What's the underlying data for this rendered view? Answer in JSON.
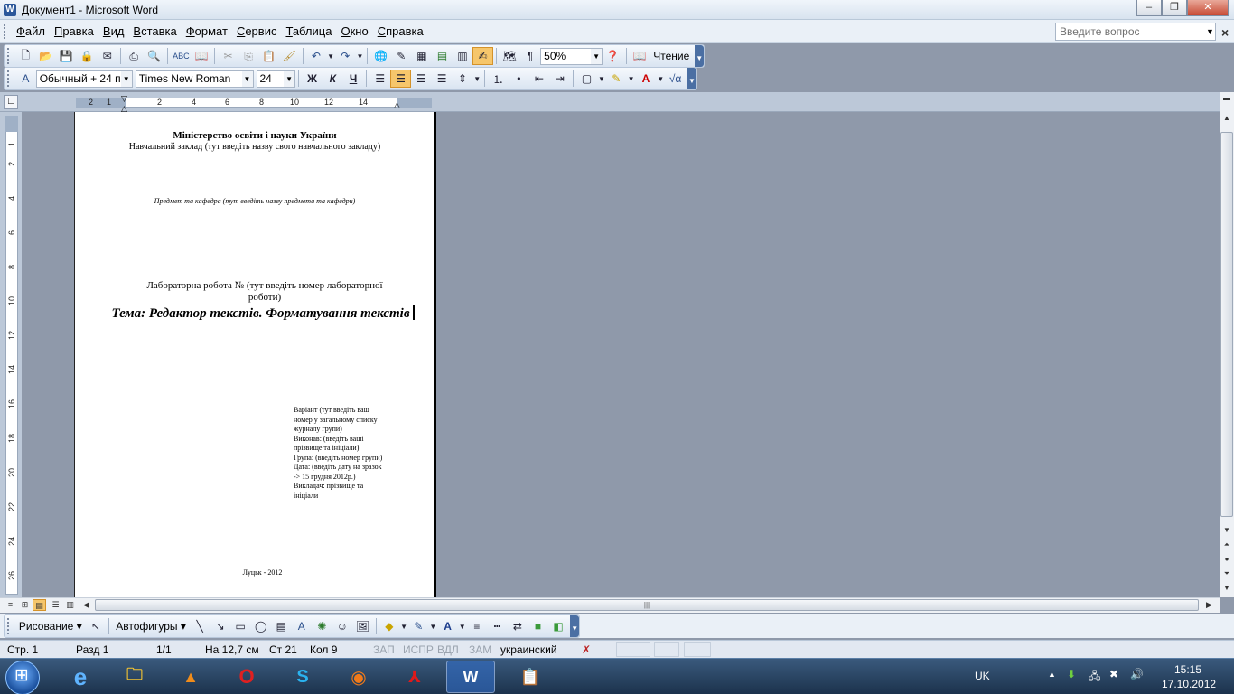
{
  "window": {
    "title": "Документ1 - Microsoft Word",
    "min": "–",
    "max": "❐",
    "close": "✕"
  },
  "menu": {
    "items": [
      "Файл",
      "Правка",
      "Вид",
      "Вставка",
      "Формат",
      "Сервис",
      "Таблица",
      "Окно",
      "Справка"
    ],
    "ask_placeholder": "Введите вопрос"
  },
  "toolbar_standard": {
    "zoom": "50%",
    "reading_label": "Чтение"
  },
  "toolbar_format": {
    "style": "Обычный + 24 п",
    "font": "Times New Roman",
    "size": "24",
    "bold": "Ж",
    "italic": "К",
    "underline": "Ч"
  },
  "ruler": {
    "h_marks": [
      "2",
      "1",
      "2",
      "4",
      "6",
      "8",
      "10",
      "12",
      "14"
    ],
    "v_marks": [
      "1",
      "2",
      "4",
      "6",
      "8",
      "10",
      "12",
      "14",
      "16",
      "18",
      "20",
      "22",
      "24",
      "26"
    ]
  },
  "document": {
    "ministry": "Міністерство освіти і науки України",
    "institution": "Навчальний заклад (тут введіть назву свого навчального закладу)",
    "subject": "Предмет та кафедра (тут введіть назву предмета та кафедри)",
    "lab_line": "Лабораторна робота № (тут введіть номер лабораторної роботи)",
    "topic": "Тема: Редактор текстів. Форматування текстів",
    "info_lines": [
      "Варіант (тут введіть ваш",
      "номер у загальному списку",
      "журналу групи)",
      "Виконав: (введіть ваші",
      "прізвище та ініціали)",
      "Група: (введіть номер групи)",
      "Дата: (введіть дату на зразок",
      "-> 15 грудня 2012р.)",
      "Викладач: прізвище та",
      "ініціали"
    ],
    "city_year": "Луцьк - 2012"
  },
  "drawing_toolbar": {
    "draw_label": "Рисование ▾",
    "autoshapes_label": "Автофигуры ▾"
  },
  "status": {
    "page": "Стр. 1",
    "section": "Разд 1",
    "pages": "1/1",
    "at": "На 12,7 см",
    "line": "Ст 21",
    "col": "Кол 9",
    "rec": "ЗАП",
    "trk": "ИСПР",
    "ext": "ВДЛ",
    "ovr": "ЗАМ",
    "language": "украинский"
  },
  "taskbar": {
    "lang": "UK",
    "time": "15:15",
    "date": "17.10.2012"
  }
}
